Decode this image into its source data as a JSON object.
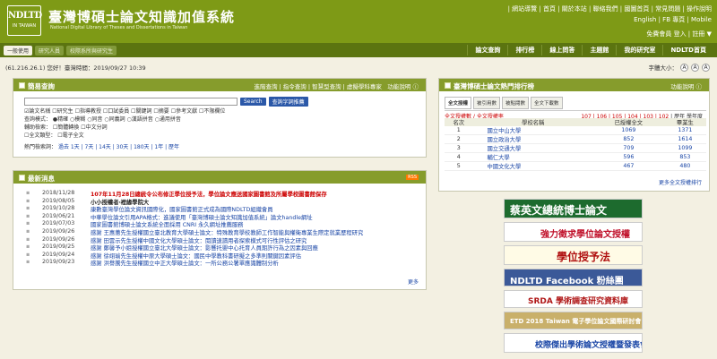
{
  "header": {
    "logo_big": "NDLTD",
    "logo_small": "IN TAIWAN",
    "title": "臺灣博碩士論文知識加值系統",
    "subtitle": "National Digital Library of Theses and Dissertations in Taiwan",
    "top_links": "| 網站導覽 | 首頁 | 關於本站 | 聯絡我們 | 國圖首頁 | 常見問題 | 操作說明",
    "lang_links": "English | FB 專頁 | Mobile",
    "login": "免費會員 登入 | 註冊 ▼"
  },
  "nav": {
    "left": [
      "一般使用",
      "研究人員",
      "校際系所與研究生"
    ],
    "right": [
      "論文查詢",
      "排行榜",
      "線上問答",
      "主題館",
      "我的研究室",
      "NDLTD首頁"
    ]
  },
  "status": {
    "ip_line": "(61.216.26.1) 您好！臺灣時間：2019/09/27 10:39",
    "font_label": "字體大小：",
    "font_sizes": [
      "A",
      "A",
      "A"
    ]
  },
  "search_panel": {
    "title": "簡易查詢",
    "right_text": "進階查詢 | 指令查詢 | 智慧型查詢 | 虛擬學科專家　功能說明 ⓘ",
    "search_button": "Search",
    "extra_button": "查詢字詞推薦",
    "fields_line": "☑論文名稱 ☐研究生 ☐指導教授 ☐口試委員 ☐關鍵詞 ☐摘要 ☐參考文獻 ☐不限欄位",
    "mode_line": "查詢模式： ●精確 ○模糊 ○同音 ○同義詞 ○漢語拼音 ○通用拼音",
    "assist_line": "輔助檢索： ☐簡體轉換 ☐中文分詞",
    "fulltext_line": "☐全文類型： ☐電子全文",
    "hot_label": "熱門檢索詞：",
    "hot_text": "過去 1天 | 7天 | 14天 | 30天 | 180天 | 1年 | 歷年"
  },
  "news_panel": {
    "title": "最新消息",
    "rss": "RSS",
    "more": "更多",
    "items": [
      {
        "date": "2018/11/28",
        "text": "107年11月28日總統令公布修正學位授予法，學位論文應送國家圖書館及所屬學校圖書館保存",
        "style": "red"
      },
      {
        "date": "2019/08/05",
        "text": "小小授權者‧裡緣學院大",
        "style": "black"
      },
      {
        "date": "2019/10/28",
        "text": "康數臺灣學位論文資訊國際化，國家圖書館正式成為國際NDLTD組織會員",
        "style": "blue"
      },
      {
        "date": "2019/06/21",
        "text": "中華學位論文引用APA格式：進議使用「臺灣博碩士論文知識加值系統」論文handle網址",
        "style": "blue"
      },
      {
        "date": "2019/07/03",
        "text": "國家圖書館博碩士論文系統全面採用 CNRI 永久網址推薦服務",
        "style": "blue"
      },
      {
        "date": "2019/09/26",
        "text": "感謝 王惠蕙先生授權國立臺北教育大學碩士論文：特殊教育學校教師工作智能與權衛專業生際定就業歷程研究",
        "style": "blue"
      },
      {
        "date": "2019/09/26",
        "text": "感謝 田雲示先生授權中國文化大學碩士論文：閱讀速讀用者探索模式可行性評估之研究",
        "style": "blue"
      },
      {
        "date": "2019/09/25",
        "text": "感謝 鄭馨予小姐授權國立臺北大學碩士論文：影響托嬰中心托育人員期許行為之因素與回應",
        "style": "blue"
      },
      {
        "date": "2019/09/24",
        "text": "感謝 徐翊瑜先生授權中原大學碩士論文：國民中學教科書研擬之多準則關鍵因素評估",
        "style": "blue"
      },
      {
        "date": "2019/09/23",
        "text": "感謝 洪譽騰先生授權國立中正大學碩士論文：一所公務公署單應識體制分析",
        "style": "blue"
      }
    ]
  },
  "rank_panel": {
    "title": "臺灣博碩士論文熱門排行榜",
    "right_text": "功能說明 ⓘ",
    "tabs": [
      "全文授權",
      "被引用數",
      "被點閱數",
      "全文下載數"
    ],
    "sub_left": "全文授權數 / 全文授權率",
    "sub_right_red": "107 | 106 | 105 | 104 | 103 | 102",
    "sub_right_rest": " | 歷年 學年度",
    "columns": [
      "名次",
      "學校名稱",
      "已授權全文",
      "畢業生"
    ],
    "rows": [
      {
        "rank": "1",
        "school": "國立中山大學",
        "authorized": "1069",
        "graduates": "1371"
      },
      {
        "rank": "2",
        "school": "國立政治大學",
        "authorized": "852",
        "graduates": "1614"
      },
      {
        "rank": "3",
        "school": "國立交通大學",
        "authorized": "709",
        "graduates": "1099"
      },
      {
        "rank": "4",
        "school": "輔仁大學",
        "authorized": "596",
        "graduates": "853"
      },
      {
        "rank": "5",
        "school": "中國文化大學",
        "authorized": "467",
        "graduates": "480"
      }
    ],
    "more": "更多全文授權排行"
  },
  "banners": [
    {
      "text": "蔡英文總統博士論文",
      "colors": [
        "#1d6b2e",
        "#ffffff"
      ]
    },
    {
      "text": "強力徵求學位論文授權",
      "colors": [
        "#ffffff",
        "#c0102a"
      ]
    },
    {
      "text": "學位授予法",
      "colors": [
        "#fffbe6",
        "#b01010"
      ]
    },
    {
      "text": "NDLTD Facebook 粉絲團",
      "colors": [
        "#3b5998",
        "#ffffff"
      ]
    },
    {
      "text": "SRDA 學術調查研究資料庫",
      "colors": [
        "#ffffff",
        "#b01818"
      ]
    },
    {
      "text": "ETD 2018 Taiwan 電子學位論文國際研討會",
      "colors": [
        "#c9b06a",
        "#ffffff"
      ]
    },
    {
      "text": "校際傑出學術論文授權暨發表會",
      "colors": [
        "#ffffff",
        "#1a46a6"
      ]
    }
  ],
  "colors": {
    "header_green": "#7e9a16",
    "nav_green": "#5b7410",
    "panel_head": "#869c2c",
    "link_blue": "#1a46a6",
    "alert_red": "#cc0000"
  }
}
